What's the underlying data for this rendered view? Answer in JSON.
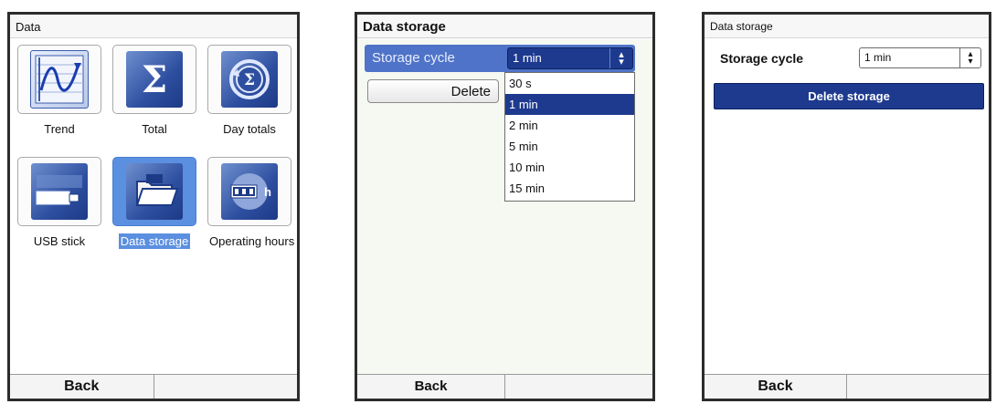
{
  "screen1": {
    "title": "Data",
    "tiles": [
      {
        "label": "Trend",
        "icon": "trend-icon"
      },
      {
        "label": "Total",
        "icon": "sigma-icon"
      },
      {
        "label": "Day totals",
        "icon": "day-totals-icon"
      },
      {
        "label": "USB stick",
        "icon": "usb-stick-icon"
      },
      {
        "label": "Data storage",
        "icon": "data-storage-icon",
        "selected": true
      },
      {
        "label": "Operating hours",
        "icon": "operating-hours-icon"
      }
    ],
    "softkeys": {
      "left": "Back",
      "right": ""
    }
  },
  "screen2": {
    "title": "Data storage",
    "storage_cycle_label": "Storage cycle",
    "storage_cycle_value": "1 min",
    "delete_label": "Delete",
    "options": [
      "30 s",
      "1 min",
      "2 min",
      "5 min",
      "10 min",
      "15 min"
    ],
    "selected_option": "1 min",
    "softkeys": {
      "left": "Back",
      "right": ""
    }
  },
  "screen3": {
    "title": "Data storage",
    "storage_cycle_label": "Storage cycle",
    "storage_cycle_value": "1 min",
    "delete_label": "Delete storage",
    "softkeys": {
      "left": "Back",
      "right": ""
    }
  },
  "colors": {
    "accent": "#1d3a8f",
    "highlight": "#4f73c8",
    "selection": "#5b8fe0"
  }
}
